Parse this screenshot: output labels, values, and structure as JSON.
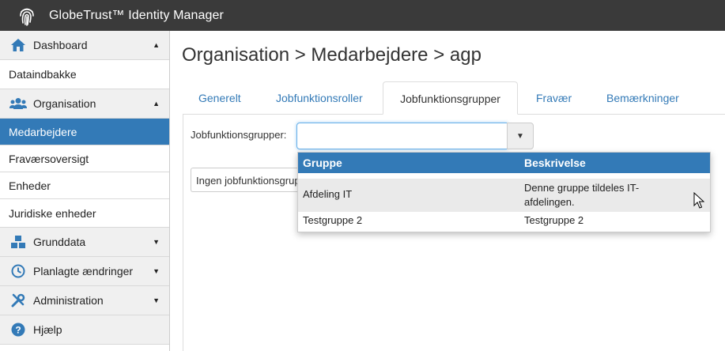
{
  "app": {
    "title": "GlobeTrust™ Identity Manager",
    "logo_icon": "fingerprint-icon"
  },
  "sidebar": {
    "items": [
      {
        "label": "Dashboard",
        "type": "section",
        "icon": "home-icon",
        "caret": "▲"
      },
      {
        "label": "Dataindbakke",
        "type": "sub"
      },
      {
        "label": "Organisation",
        "type": "section",
        "icon": "users-icon",
        "caret": "▲"
      },
      {
        "label": "Medarbejdere",
        "type": "sub",
        "active": true
      },
      {
        "label": "Fraværsoversigt",
        "type": "sub"
      },
      {
        "label": "Enheder",
        "type": "sub"
      },
      {
        "label": "Juridiske enheder",
        "type": "sub"
      },
      {
        "label": "Grunddata",
        "type": "section",
        "icon": "cubes-icon",
        "caret": "▼"
      },
      {
        "label": "Planlagte ændringer",
        "type": "section",
        "icon": "clock-icon",
        "caret": "▼"
      },
      {
        "label": "Administration",
        "type": "section",
        "icon": "wrench-icon",
        "caret": "▼"
      },
      {
        "label": "Hjælp",
        "type": "section",
        "icon": "question-icon"
      }
    ]
  },
  "page": {
    "title": "Organisation > Medarbejdere > agp"
  },
  "tabs": [
    {
      "label": "Generelt"
    },
    {
      "label": "Jobfunktionsroller"
    },
    {
      "label": "Jobfunktionsgrupper",
      "active": true
    },
    {
      "label": "Fravær"
    },
    {
      "label": "Bemærkninger"
    }
  ],
  "form": {
    "label": "Jobfunktionsgrupper:",
    "value": "",
    "empty_text": "Ingen jobfunktionsgrupper"
  },
  "dropdown": {
    "columns": [
      "Gruppe",
      "Beskrivelse"
    ],
    "rows": [
      {
        "gruppe": "Afdeling IT",
        "beskrivelse": "Denne gruppe tildeles IT-afdelingen.",
        "highlighted": true
      },
      {
        "gruppe": "Testgruppe 2",
        "beskrivelse": "Testgruppe 2"
      }
    ]
  },
  "colors": {
    "topbar": "#3a3a3a",
    "accent": "#337ab7"
  }
}
